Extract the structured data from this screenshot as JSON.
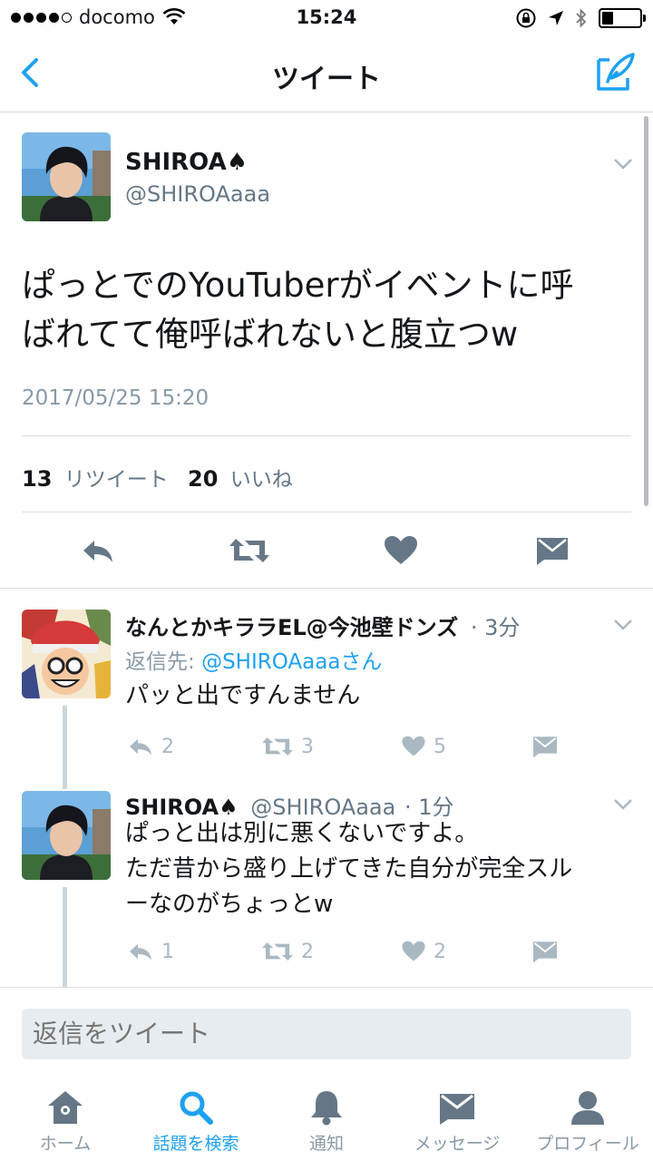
{
  "status_bar": {
    "carrier": "docomo",
    "time": "15:24",
    "battery_level": 0.3
  },
  "nav": {
    "title": "ツイート"
  },
  "main_tweet": {
    "name": "SHIROA♠",
    "handle": "@SHIROAaaa",
    "text_line1": "ぱっとでのYouTuberがイベントに呼",
    "text_line2": "ばれてて俺呼ばれないと腹立つw",
    "timestamp": "2017/05/25 15:20",
    "retweet_count": "13",
    "retweet_label": "リツイート",
    "like_count": "20",
    "like_label": "いいね"
  },
  "replies": [
    {
      "name": "なんとかキララEL@今池壁ドンズ",
      "time": "· 3分",
      "reply_to_prefix": "返信先: ",
      "reply_to_handle": "@SHIROAaaaさん",
      "text_line1": "パッと出ですんません",
      "reply_count": "2",
      "retweet_count": "3",
      "like_count": "5"
    },
    {
      "name": "SHIROA♠",
      "handle": "@SHIROAaaa",
      "time": "· 1分",
      "text_line1": "ぱっと出は別に悪くないですよ。",
      "text_line2": "ただ昔から盛り上げてきた自分が完全スル",
      "text_line3": "ーなのがちょっとw",
      "reply_count": "1",
      "retweet_count": "2",
      "like_count": "2"
    }
  ],
  "reply_bar": {
    "placeholder": "返信をツイート"
  },
  "tabs": [
    {
      "label": "ホーム",
      "icon": "home-icon"
    },
    {
      "label": "話題を検索",
      "icon": "search-icon"
    },
    {
      "label": "通知",
      "icon": "bell-icon"
    },
    {
      "label": "メッセージ",
      "icon": "envelope-icon"
    },
    {
      "label": "プロフィール",
      "icon": "person-icon"
    }
  ],
  "colors": {
    "accent": "#1da1f2",
    "icon_gray": "#657786",
    "muted": "#8899a6",
    "light_icon": "#aab8c2"
  }
}
